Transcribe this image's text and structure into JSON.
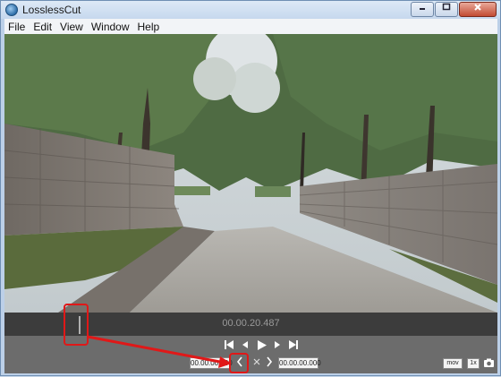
{
  "window": {
    "title": "LosslessCut"
  },
  "menu": [
    "File",
    "Edit",
    "View",
    "Window",
    "Help"
  ],
  "player": {
    "current_time": "00.00.20.487",
    "cut_start": "00.00.00.000",
    "cut_end": "00.00.00.000",
    "format_label": "mov",
    "playback_rate": "1x"
  },
  "icons": {
    "app": "app-icon",
    "minimize": "minimize-icon",
    "maximize": "maximize-icon",
    "close": "close-icon",
    "jump_start": "skip-to-start-icon",
    "frame_back": "step-back-icon",
    "play": "play-icon",
    "frame_forward": "step-forward-icon",
    "jump_end": "skip-to-end-icon",
    "prev_cut": "chevron-left-icon",
    "segment": "segment-icon",
    "next_cut": "chevron-right-icon",
    "capture": "camera-icon"
  },
  "colors": {
    "highlight": "#e01818",
    "timeline_bg": "#3c3c3c",
    "controls_bg": "#6c6c6c"
  }
}
